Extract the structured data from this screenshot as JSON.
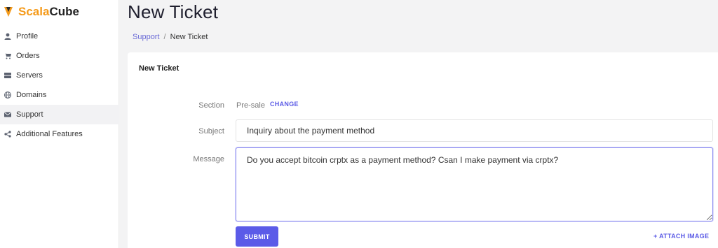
{
  "brand": {
    "part1": "Scala",
    "part2": "Cube",
    "accent": "#f59b1b"
  },
  "sidebar": {
    "items": [
      {
        "label": "Profile",
        "icon": "user-icon"
      },
      {
        "label": "Orders",
        "icon": "cart-icon"
      },
      {
        "label": "Servers",
        "icon": "server-icon"
      },
      {
        "label": "Domains",
        "icon": "globe-icon"
      },
      {
        "label": "Support",
        "icon": "envelope-icon",
        "active": true
      },
      {
        "label": "Additional Features",
        "icon": "share-icon"
      }
    ]
  },
  "header": {
    "title": "New Ticket",
    "breadcrumb": {
      "link": "Support",
      "separator": "/",
      "current": "New Ticket"
    }
  },
  "form": {
    "card_title": "New Ticket",
    "section": {
      "label": "Section",
      "value": "Pre-sale",
      "change_label": "CHANGE"
    },
    "subject": {
      "label": "Subject",
      "value": "Inquiry about the payment method"
    },
    "message": {
      "label": "Message",
      "value": "Do you accept bitcoin crptx as a payment method? Csan I make payment via crptx?"
    },
    "submit_label": "SUBMIT",
    "attach_label": "+ ATTACH IMAGE"
  },
  "colors": {
    "primary": "#5b5be8",
    "link": "#6a6ad6"
  }
}
